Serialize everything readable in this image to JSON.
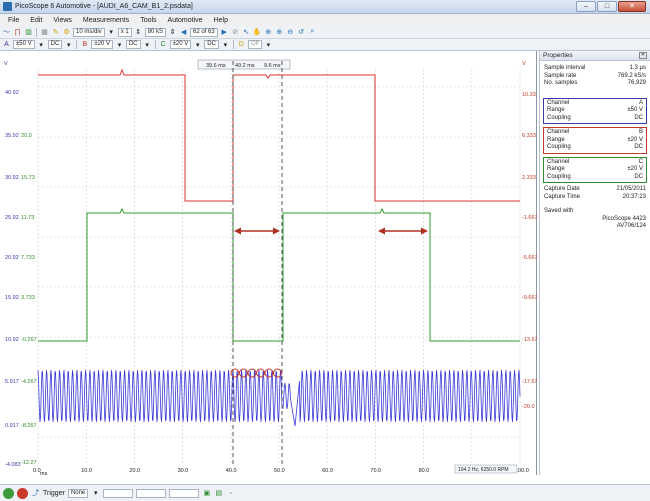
{
  "window": {
    "title": "PicoScope 6 Automotive - [AUDI_A6_CAM_B1_2.psdata]",
    "buttons": [
      "–",
      "□",
      "✕"
    ]
  },
  "menu": [
    "File",
    "Edit",
    "Views",
    "Measurements",
    "Tools",
    "Automotive",
    "Help"
  ],
  "toolbar1": {
    "timebase": "10 ms/div",
    "zoom": "x 1",
    "samples": "80 kS",
    "buffer": "62 of 63"
  },
  "toolbar2": {
    "chA_range": "±50 V",
    "chA_coupling": "DC",
    "chB_range": "±20 V",
    "chB_coupling": "DC",
    "chC_range": "±20 V",
    "chC_coupling": "DC",
    "chD_state": "Off"
  },
  "ruler_readout": {
    "left": "39.6 ms",
    "mid": "49.2 ms",
    "delta": "9.6 ms"
  },
  "axes": {
    "left_outer": [
      "40.92",
      "35.92",
      "30.92",
      "25.92",
      "20.92",
      "15.92",
      "10.92",
      "5.917",
      "0.917",
      "-4.083"
    ],
    "left_inner": [
      "20.0",
      "15.73",
      "11.73",
      "7.733",
      "3.733",
      "-0.267",
      "-4.267",
      "-8.267",
      "-12.27"
    ],
    "right": [
      "10.33",
      "6.333",
      "2.333",
      "-1.667",
      "-5.667",
      "-9.667",
      "-13.67",
      "-17.67",
      "-20.0"
    ],
    "x": [
      "0.0",
      "10.0",
      "20.0",
      "30.0",
      "40.0",
      "50.0",
      "60.0",
      "70.0",
      "80.0",
      "90.0",
      "100.0"
    ],
    "x_unit": "ms",
    "unit_left": "V",
    "unit_right": "V"
  },
  "freq_readout": "104.2 Hz, 6250.0 RPM",
  "properties": {
    "title": "Properties",
    "summary": [
      [
        "Sample interval",
        "1.3 µs"
      ],
      [
        "Sample rate",
        "769.2 kS/s"
      ],
      [
        "No. samples",
        "76,929"
      ]
    ],
    "channels": [
      {
        "color": "#3a3aa8",
        "rows": [
          [
            "Channel",
            "A"
          ],
          [
            "Range",
            "±50 V"
          ],
          [
            "Coupling",
            "DC"
          ]
        ]
      },
      {
        "color": "#c0392b",
        "rows": [
          [
            "Channel",
            "B"
          ],
          [
            "Range",
            "±20 V"
          ],
          [
            "Coupling",
            "DC"
          ]
        ]
      },
      {
        "color": "#2e8b2e",
        "rows": [
          [
            "Channel",
            "C"
          ],
          [
            "Range",
            "±20 V"
          ],
          [
            "Coupling",
            "DC"
          ]
        ]
      }
    ],
    "capture": [
      [
        "Capture Date",
        "21/05/2011"
      ],
      [
        "Capture Time",
        "20:37:23"
      ]
    ],
    "saved_with_label": "Saved with",
    "saved_with_device": "PicoScope 4423",
    "saved_with_serial": "AV706/124"
  },
  "bottom": {
    "trigger_label": "Trigger",
    "trigger_value": "None"
  },
  "colors": {
    "chA": "#3a3ad8",
    "chB": "#e03030",
    "chC": "#2e9e2e",
    "grid": "#d0d0d0"
  }
}
